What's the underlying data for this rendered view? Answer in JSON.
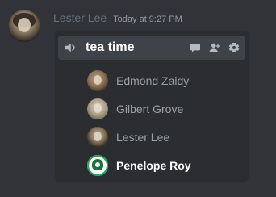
{
  "message": {
    "author": "Lester Lee",
    "timestamp": "Today at 9:27 PM"
  },
  "voice_channel": {
    "name": "tea time",
    "icons": {
      "speaker": "speaker-icon",
      "chat": "chat-bubble-icon",
      "add_user": "add-user-icon",
      "settings": "gear-icon"
    },
    "members": [
      {
        "name": "Edmond Zaidy",
        "active": false
      },
      {
        "name": "Gilbert Grove",
        "active": false
      },
      {
        "name": "Lester Lee",
        "active": false
      },
      {
        "name": "Penelope Roy",
        "active": true
      }
    ]
  },
  "colors": {
    "background": "#313338",
    "card_background": "#2b2d31",
    "card_header_background": "#404249",
    "muted_text": "#9aa0a8",
    "username": "#69707b",
    "active_text": "#ffffff",
    "speaking_ring": "#23a55a"
  }
}
